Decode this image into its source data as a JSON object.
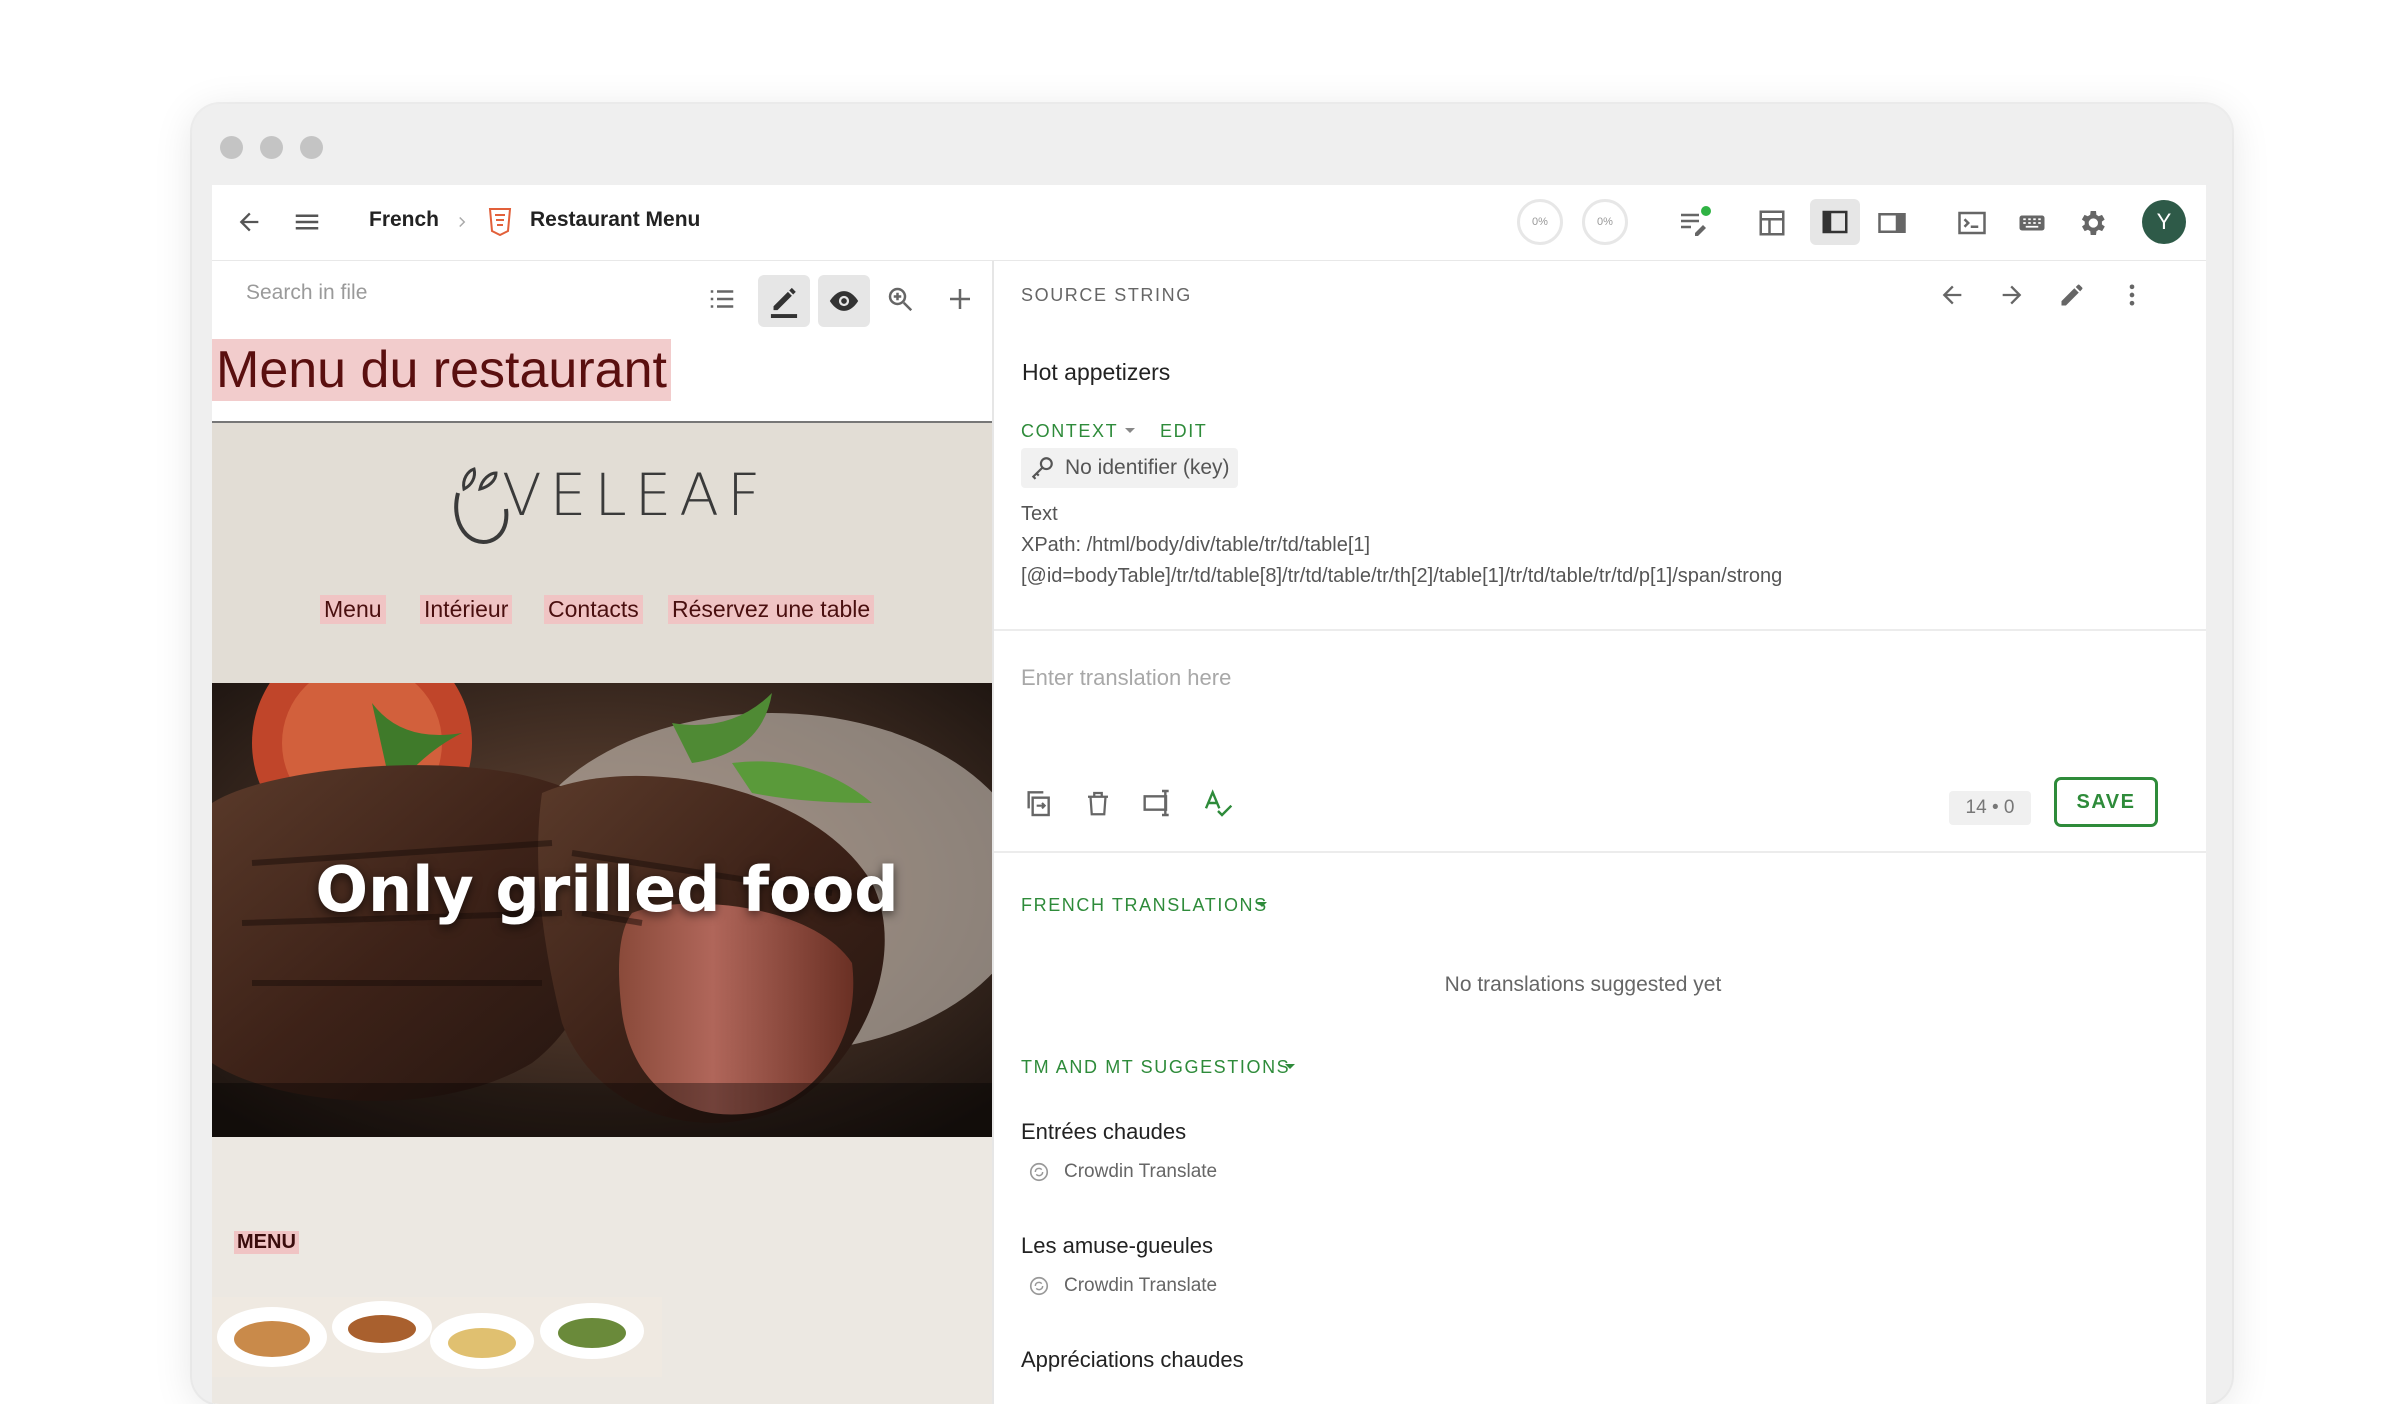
{
  "breadcrumb": {
    "language": "French",
    "file": "Restaurant Menu"
  },
  "progress": {
    "translated": "0%",
    "approved": "0%"
  },
  "user": {
    "initial": "Y"
  },
  "left_panel": {
    "search_placeholder": "Search in file",
    "preview": {
      "page_title": "Menu du restaurant",
      "logo_text": "LOVELEAF",
      "nav_items": [
        "Menu",
        "Intérieur",
        "Contacts",
        "Réservez une table"
      ],
      "hero_text": "Only grilled food",
      "section_label": "MENU"
    }
  },
  "right_panel": {
    "source_label": "SOURCE STRING",
    "source_text": "Hot appetizers",
    "context_label": "CONTEXT",
    "edit_label": "EDIT",
    "identifier": "No identifier (key)",
    "context_type": "Text",
    "xpath_line1": "XPath: /html/body/div/table/tr/td/table[1]",
    "xpath_line2": "[@id=bodyTable]/tr/td/table[8]/tr/td/table/tr/th[2]/table[1]/tr/td/table/tr/td/p[1]/span/strong",
    "translation_placeholder": "Enter translation here",
    "counter": "14 • 0",
    "save_label": "SAVE",
    "translations_label": "FRENCH TRANSLATIONS",
    "no_translations": "No translations suggested yet",
    "tm_label": "TM AND MT SUGGESTIONS",
    "suggestions": [
      {
        "text": "Entrées chaudes",
        "engine": "Crowdin Translate"
      },
      {
        "text": "Les amuse-gueules",
        "engine": "Crowdin Translate"
      },
      {
        "text": "Appréciations chaudes"
      }
    ]
  },
  "colors": {
    "accent": "#2e8b3a",
    "avatar": "#2e5a48",
    "status_dot": "#2fb344",
    "highlight": "#f0c4c4"
  }
}
